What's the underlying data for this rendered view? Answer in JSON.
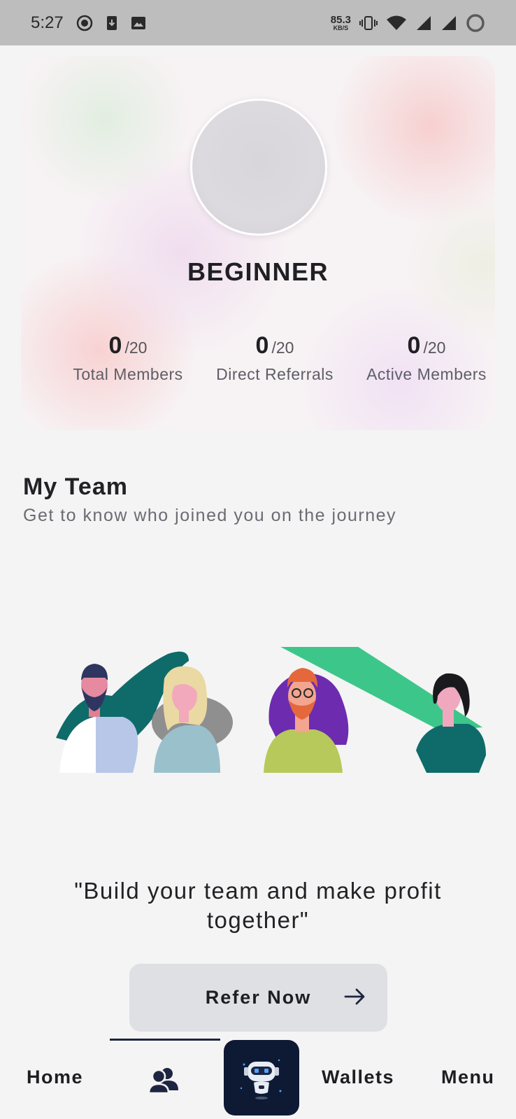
{
  "status_bar": {
    "time": "5:27",
    "net_speed_value": "85.3",
    "net_speed_unit": "KB/S"
  },
  "rank": {
    "title": "BEGINNER",
    "stats": [
      {
        "value": "0",
        "max": "/20",
        "label": "Total Members"
      },
      {
        "value": "0",
        "max": "/20",
        "label": "Direct Referrals"
      },
      {
        "value": "0",
        "max": "/20",
        "label": "Active Members"
      }
    ]
  },
  "team": {
    "title": "My Team",
    "subtitle": "Get to know who joined you on the journey"
  },
  "quote": "\"Build your team and make profit together\"",
  "refer_button": {
    "label": "Refer Now",
    "icon": "arrow-right-icon"
  },
  "nav": {
    "home": "Home",
    "team_icon": "team-icon",
    "bot_icon": "robot-icon",
    "wallets": "Wallets",
    "menu": "Menu",
    "active": "team"
  },
  "colors": {
    "accent_dark": "#0e1a34",
    "teal": "#0f6b6a",
    "green": "#3dc68a",
    "purple": "#6d2bb0",
    "button_bg": "#dfe0e3"
  }
}
